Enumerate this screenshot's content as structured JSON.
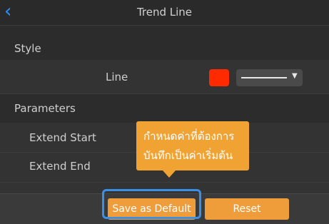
{
  "header": {
    "title": "Trend Line",
    "back_icon": "chevron-left-icon"
  },
  "style_section": {
    "label": "Style"
  },
  "line_row": {
    "label": "Line",
    "color": "#ff2a00"
  },
  "parameters_section": {
    "label": "Parameters"
  },
  "extend_start": {
    "label": "Extend Start"
  },
  "extend_end": {
    "label": "Extend End"
  },
  "tooltip": {
    "line1": "กำหนดค่าที่ต้องการ",
    "line2": "บันทึกเป็นค่าเริ่มต้น"
  },
  "footer": {
    "save_default_label": "Save as Default",
    "reset_label": "Reset"
  },
  "colors": {
    "accent": "#ee9d3a",
    "highlight": "#3a8fe6",
    "back": "#2f8fff"
  }
}
